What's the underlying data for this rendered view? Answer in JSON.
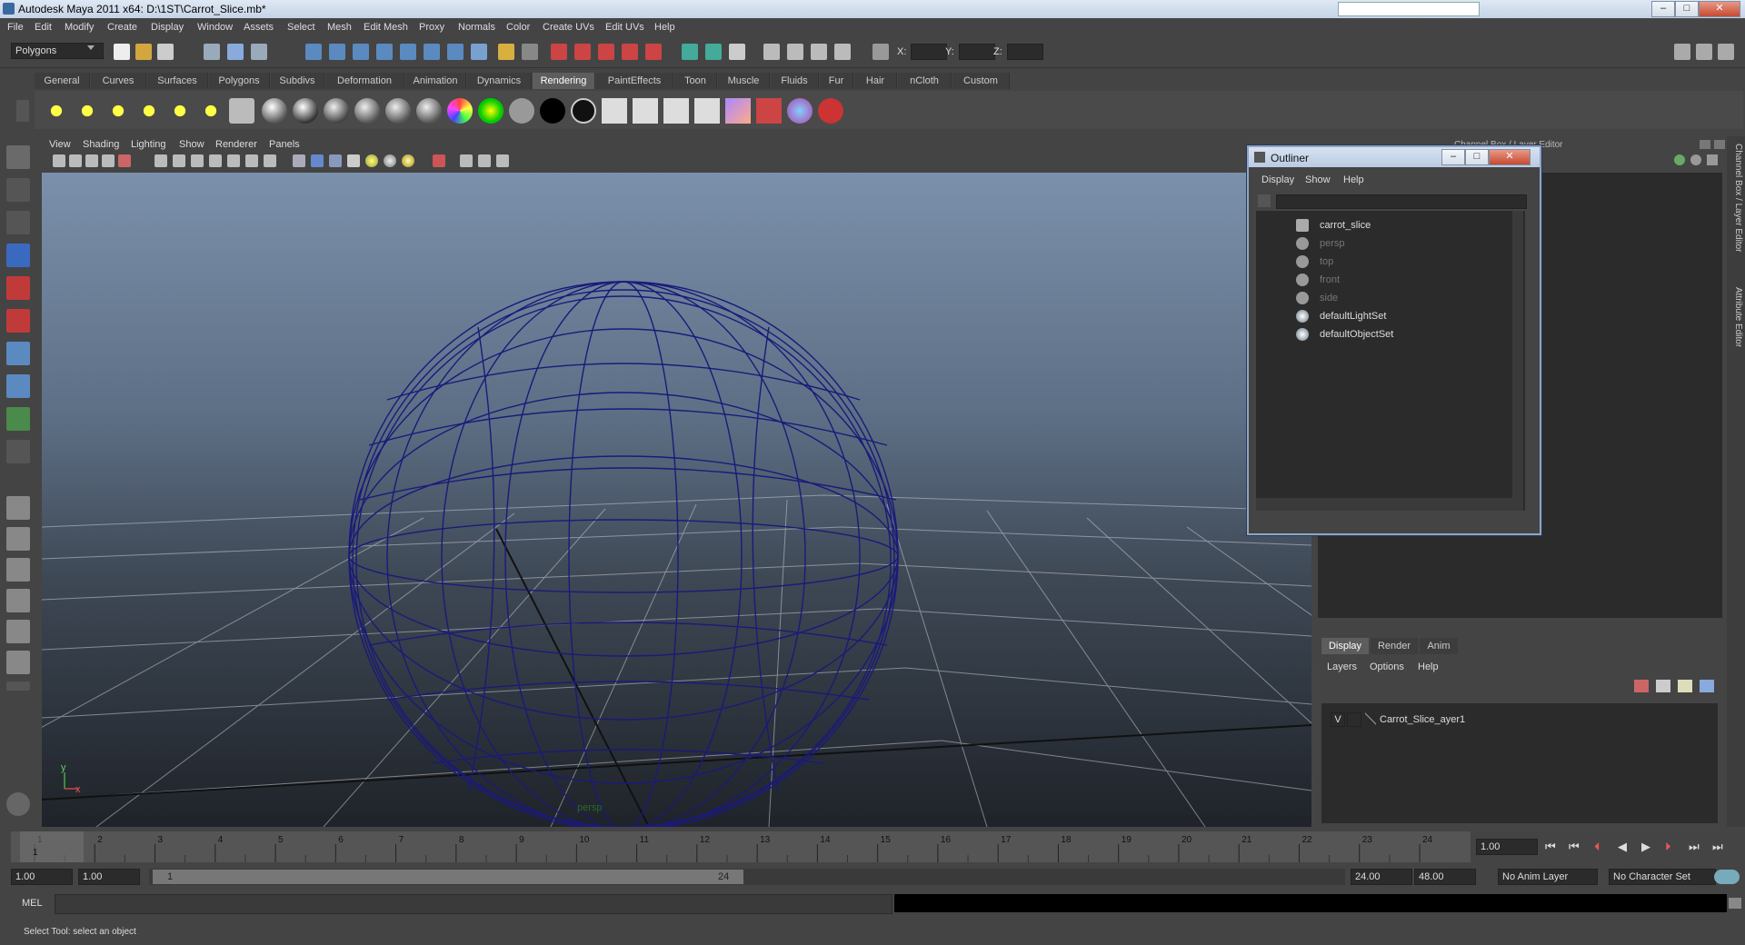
{
  "window": {
    "title": "Autodesk Maya 2011 x64: D:\\1ST\\Carrot_Slice.mb*",
    "min": "–",
    "max": "□",
    "close": "✕"
  },
  "menubar": [
    "File",
    "Edit",
    "Modify",
    "Create",
    "Display",
    "Window",
    "Assets",
    "Select",
    "Mesh",
    "Edit Mesh",
    "Proxy",
    "Normals",
    "Color",
    "Create UVs",
    "Edit UVs",
    "Help"
  ],
  "statusline": {
    "menu_set": "Polygons",
    "x_label": "X:",
    "y_label": "Y:",
    "z_label": "Z:"
  },
  "shelf_tabs": [
    "General",
    "Curves",
    "Surfaces",
    "Polygons",
    "Subdivs",
    "Deformation",
    "Animation",
    "Dynamics",
    "Rendering",
    "PaintEffects",
    "Toon",
    "Muscle",
    "Fluids",
    "Fur",
    "Hair",
    "nCloth",
    "Custom"
  ],
  "shelf_active": "Rendering",
  "viewport": {
    "menus": [
      "View",
      "Shading",
      "Lighting",
      "Show",
      "Renderer",
      "Panels"
    ],
    "camera_label": "persp",
    "axis_y": "y",
    "axis_x": "x"
  },
  "outliner": {
    "title": "Outliner",
    "menus": [
      "Display",
      "Show",
      "Help"
    ],
    "items": [
      {
        "label": "carrot_slice",
        "dim": false,
        "icon": "mesh-icon"
      },
      {
        "label": "persp",
        "dim": true,
        "icon": "camera-icon"
      },
      {
        "label": "top",
        "dim": true,
        "icon": "camera-icon"
      },
      {
        "label": "front",
        "dim": true,
        "icon": "camera-icon"
      },
      {
        "label": "side",
        "dim": true,
        "icon": "camera-icon"
      },
      {
        "label": "defaultLightSet",
        "dim": false,
        "icon": "set-icon"
      },
      {
        "label": "defaultObjectSet",
        "dim": false,
        "icon": "set-icon"
      }
    ]
  },
  "rpanel": {
    "header": "Channel Box / Layer Editor",
    "layer_tabs": [
      "Display",
      "Render",
      "Anim"
    ],
    "layer_menus": [
      "Layers",
      "Options",
      "Help"
    ],
    "layer": {
      "visible": "V",
      "name": "Carrot_Slice_ayer1"
    }
  },
  "side_tabs": [
    "Channel Box / Layer Editor",
    "Attribute Editor"
  ],
  "timeline": {
    "ticks": [
      "1",
      "2",
      "3",
      "4",
      "5",
      "6",
      "7",
      "8",
      "9",
      "10",
      "11",
      "12",
      "13",
      "14",
      "15",
      "16",
      "17",
      "18",
      "19",
      "20",
      "21",
      "22",
      "23",
      "24"
    ],
    "current_frame": "1",
    "current_time_field": "1.00"
  },
  "range": {
    "start": "1.00",
    "playback_start": "1.00",
    "slider_start": "1",
    "slider_end": "24",
    "playback_end": "24.00",
    "end": "48.00",
    "anim_layer": "No Anim Layer",
    "character_set": "No Character Set"
  },
  "cmdline": {
    "label": "MEL"
  },
  "helpline": {
    "text": "Select Tool: select an object"
  }
}
